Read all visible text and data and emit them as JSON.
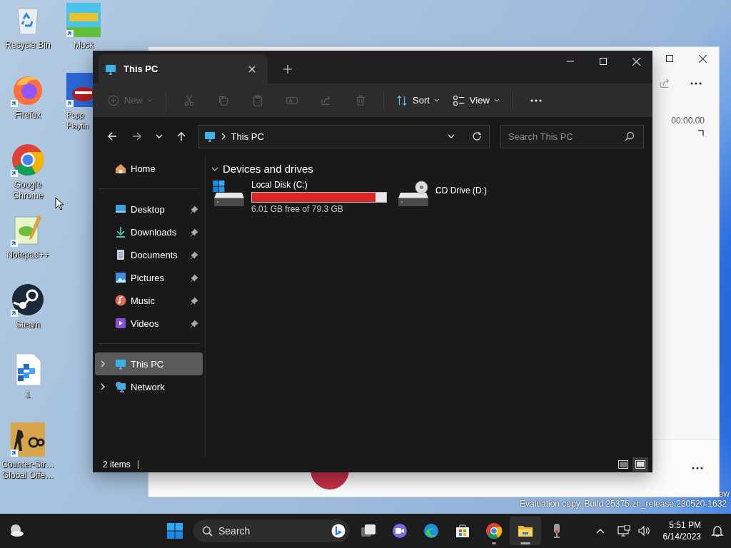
{
  "desktop": {
    "icons": [
      {
        "label": "Recycle Bin",
        "kind": "recycle",
        "shortcut": false
      },
      {
        "label": "Firefox",
        "kind": "firefox",
        "shortcut": true
      },
      {
        "label": "Google Chrome",
        "kind": "chrome",
        "shortcut": true
      },
      {
        "label": "Notepad++",
        "kind": "notepad",
        "shortcut": true
      },
      {
        "label": "Steam",
        "kind": "steam",
        "shortcut": true
      },
      {
        "label": "1",
        "kind": "registry",
        "shortcut": false
      },
      {
        "label": "Counter-Str… Global Offe…",
        "kind": "game",
        "shortcut": true
      },
      {
        "label": "Muck",
        "kind": "muck",
        "shortcut": true
      },
      {
        "label": "Popp Playtin",
        "kind": "poppy",
        "shortcut": true
      }
    ]
  },
  "build_info": [
    "ew",
    "Evaluation copy. Build 25375.zn_release.230520-1632"
  ],
  "recorder_window": {
    "timer": "00:00.00"
  },
  "explorer": {
    "tabs": [
      {
        "title": "This PC",
        "selected": true
      }
    ],
    "toolbar": [
      {
        "label": "New",
        "kind": "new",
        "disabled": true
      },
      {
        "kind": "cut",
        "disabled": true
      },
      {
        "kind": "copy",
        "disabled": true
      },
      {
        "kind": "paste",
        "disabled": true
      },
      {
        "kind": "rename",
        "disabled": true
      },
      {
        "kind": "share",
        "disabled": true
      },
      {
        "kind": "delete",
        "disabled": true
      },
      {
        "label": "Sort",
        "kind": "sort",
        "disabled": false
      },
      {
        "label": "View",
        "kind": "view",
        "disabled": false
      },
      {
        "kind": "more",
        "disabled": false
      }
    ],
    "address": {
      "path": "This PC"
    },
    "search": {
      "placeholder": "Search This PC"
    },
    "sidebar": {
      "sections": [
        [
          {
            "label": "Home",
            "kind": "home",
            "selected": false
          }
        ],
        [
          {
            "label": "Desktop",
            "kind": "desktop",
            "pinned": true,
            "selected": false
          },
          {
            "label": "Downloads",
            "kind": "downloads",
            "pinned": true,
            "selected": false
          },
          {
            "label": "Documents",
            "kind": "documents",
            "pinned": true,
            "selected": false
          },
          {
            "label": "Pictures",
            "kind": "pictures",
            "pinned": true,
            "selected": false
          },
          {
            "label": "Music",
            "kind": "music",
            "pinned": true,
            "selected": false
          },
          {
            "label": "Videos",
            "kind": "videos",
            "pinned": true,
            "selected": false
          }
        ],
        [
          {
            "label": "This PC",
            "kind": "pc",
            "expanded": false,
            "selected": true
          },
          {
            "label": "Network",
            "kind": "network",
            "expanded": false,
            "selected": false
          }
        ]
      ]
    },
    "groups": [
      {
        "title": "Devices and drives",
        "expanded": true,
        "drives": [
          {
            "name": "Local Disk (C:)",
            "kind": "system",
            "level": 0.92,
            "space": "6.01 GB free of 79.3 GB"
          },
          {
            "name": "CD Drive (D:)",
            "kind": "cd"
          }
        ]
      }
    ],
    "status_bar": {
      "item_count": "2 items",
      "views": [
        {
          "kind": "details",
          "selected": false
        },
        {
          "kind": "tiles",
          "selected": true
        }
      ]
    }
  },
  "taskbar": {
    "search_placeholder": "Search",
    "apps": [
      {
        "kind": "taskview",
        "running": false,
        "active": false
      },
      {
        "kind": "chat",
        "running": false,
        "active": false
      },
      {
        "kind": "edge",
        "running": false,
        "active": false
      },
      {
        "kind": "store",
        "running": false,
        "active": false
      },
      {
        "kind": "chrome",
        "running": true,
        "active": false
      },
      {
        "kind": "explorer",
        "running": true,
        "active": true
      },
      {
        "kind": "microphone",
        "running": false,
        "active": false
      }
    ],
    "clock": {
      "time": "5:51 PM",
      "date": "6/14/2023"
    }
  }
}
